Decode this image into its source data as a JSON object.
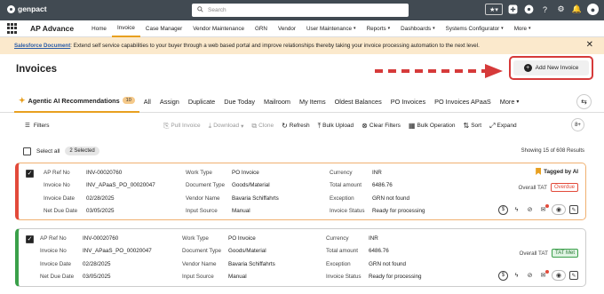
{
  "topbar": {
    "brand": "genpact",
    "search_placeholder": "Search",
    "icons": [
      "star-menu-icon",
      "add-icon",
      "grid-icon",
      "settings-icon",
      "help-icon",
      "user-icon"
    ]
  },
  "nav": {
    "app_name": "AP Advance",
    "items": [
      {
        "label": "Home",
        "caret": false
      },
      {
        "label": "Invoice",
        "caret": false,
        "active": true
      },
      {
        "label": "Case Manager",
        "caret": false
      },
      {
        "label": "Vendor Maintenance",
        "caret": false
      },
      {
        "label": "GRN",
        "caret": false
      },
      {
        "label": "Vendor",
        "caret": false
      },
      {
        "label": "User Maintenance",
        "caret": true
      },
      {
        "label": "Reports",
        "caret": true
      },
      {
        "label": "Dashboards",
        "caret": true
      },
      {
        "label": "Systems Configurator",
        "caret": true
      },
      {
        "label": "More",
        "caret": true
      }
    ]
  },
  "banner": {
    "link": "Salesforce Document",
    "text": " : Extend self service capabilities to your buyer through a web based portal and improve relationships thereby taking your invoice processing automation to the next level."
  },
  "page": {
    "title": "Invoices",
    "add_button": "Add New Invoice"
  },
  "tabs": [
    {
      "label": "Agentic AI Recommendations",
      "badge": "10",
      "active": true
    },
    {
      "label": "All"
    },
    {
      "label": "Assign"
    },
    {
      "label": "Duplicate"
    },
    {
      "label": "Due Today"
    },
    {
      "label": "Mailroom"
    },
    {
      "label": "My Items"
    },
    {
      "label": "Oldest Balances"
    },
    {
      "label": "PO Invoices"
    },
    {
      "label": "PO Invoices APaaS"
    },
    {
      "label": "More",
      "caret": true
    }
  ],
  "toolbar": {
    "filters": "Filters",
    "actions": [
      {
        "label": "Pull Invoice",
        "disabled": true,
        "icon": "pull-icon"
      },
      {
        "label": "Download",
        "disabled": true,
        "icon": "download-icon",
        "caret": true
      },
      {
        "label": "Clone",
        "disabled": true,
        "icon": "clone-icon"
      },
      {
        "label": "Refresh",
        "disabled": false,
        "icon": "refresh-icon"
      },
      {
        "label": "Bulk Upload",
        "disabled": false,
        "icon": "upload-icon"
      },
      {
        "label": "Clear Filters",
        "disabled": false,
        "icon": "clear-filter-icon"
      },
      {
        "label": "Bulk Operation",
        "disabled": false,
        "icon": "bulk-operation-icon"
      },
      {
        "label": "Sort",
        "disabled": false,
        "icon": "sort-icon"
      },
      {
        "label": "Expand",
        "disabled": false,
        "icon": "expand-icon"
      }
    ],
    "more_count": "8+"
  },
  "selection": {
    "select_all": "Select all",
    "selected": "2 Selected",
    "showing": "Showing 15 of 608 Results"
  },
  "cards": [
    {
      "color": "#e24a3a",
      "tagged": "Tagged by AI",
      "ap_ref_label": "AP Ref No",
      "ap_ref": "INV-00020760",
      "invoice_no_label": "Invoice No",
      "invoice_no": "INV_APaaS_PO_00020047",
      "invoice_date_label": "Invoice Date",
      "invoice_date": "02/28/2025",
      "net_due_label": "Net Due Date",
      "net_due": "03/05/2025",
      "work_type_label": "Work Type",
      "work_type": "PO Invoice",
      "doc_type_label": "Document Type",
      "doc_type": "Goods/Material",
      "vendor_label": "Vendor Name",
      "vendor": "Bavaria Schiffahrts",
      "input_label": "Input Source",
      "input": "Manual",
      "currency_label": "Currency",
      "currency": "INR",
      "total_label": "Total amount",
      "total": "6486.76",
      "exception_label": "Exception",
      "exception": "GRN not found",
      "status_label": "Invoice Status",
      "status": "Ready for processing",
      "tat_label": "Overall TAT",
      "tat": "Overdue"
    },
    {
      "color": "#3aa04a",
      "tagged": "",
      "ap_ref_label": "AP Ref No",
      "ap_ref": "INV-00020760",
      "invoice_no_label": "Invoice No",
      "invoice_no": "INV_APaaS_PO_00020047",
      "invoice_date_label": "Invoice Date",
      "invoice_date": "02/28/2025",
      "net_due_label": "Net Due Date",
      "net_due": "03/05/2025",
      "work_type_label": "Work Type",
      "work_type": "PO Invoice",
      "doc_type_label": "Document Type",
      "doc_type": "Goods/Material",
      "vendor_label": "Vendor Name",
      "vendor": "Bavaria Schiffahrts",
      "input_label": "Input Source",
      "input": "Manual",
      "currency_label": "Currency",
      "currency": "INR",
      "total_label": "Total amount",
      "total": "6486.76",
      "exception_label": "Exception",
      "exception": "GRN not found",
      "status_label": "Invoice Status",
      "status": "Ready for processing",
      "tat_label": "Overall TAT",
      "tat": "TAT Met"
    }
  ]
}
